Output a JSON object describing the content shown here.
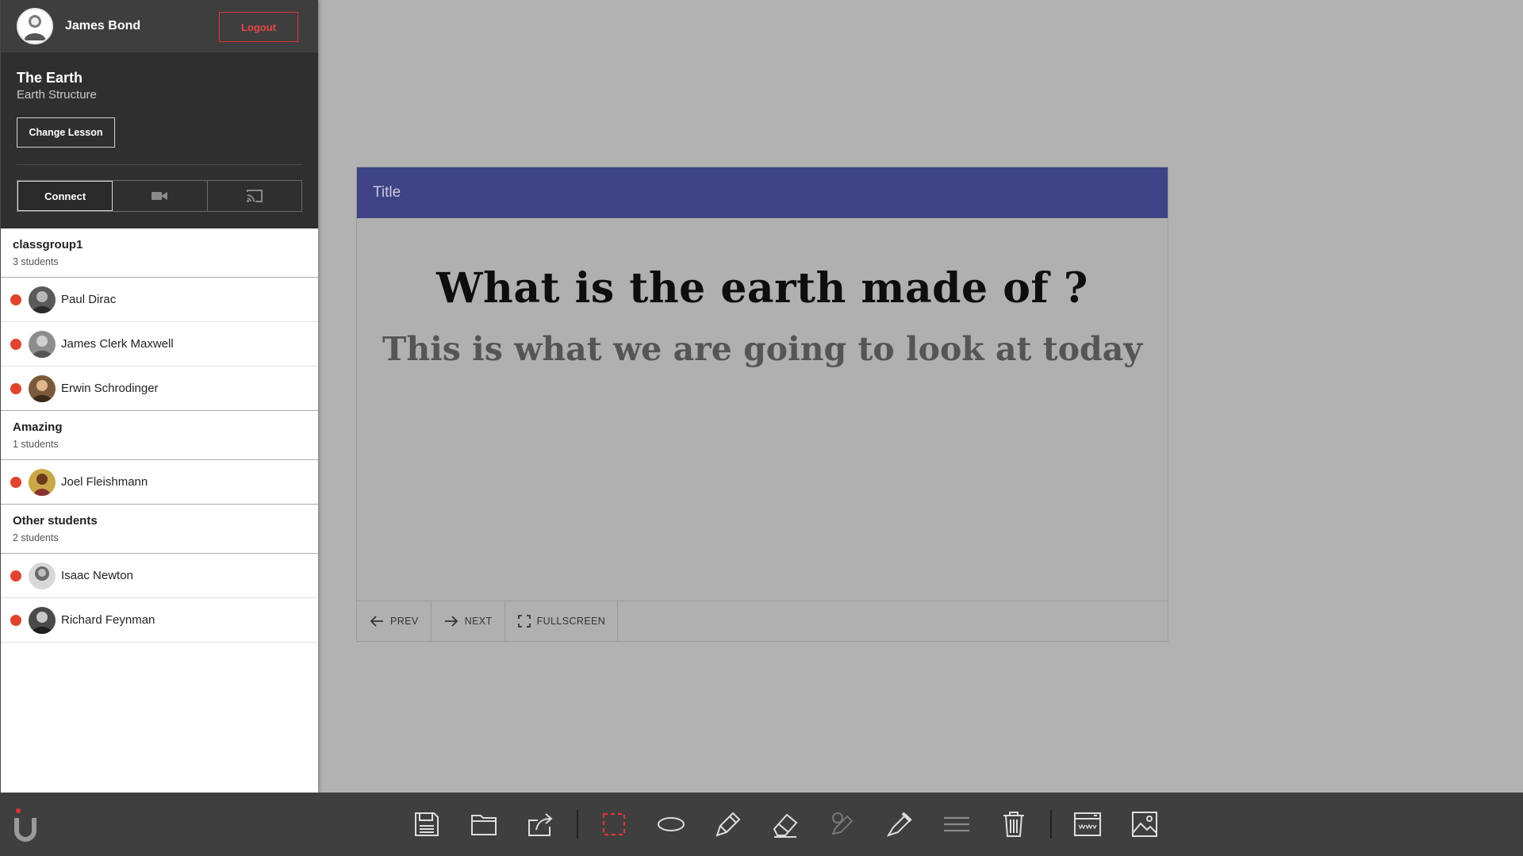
{
  "user": {
    "name": "James Bond",
    "logout_label": "Logout"
  },
  "lesson": {
    "title": "The Earth",
    "subtitle": "Earth Structure",
    "change_label": "Change Lesson"
  },
  "connect": {
    "label": "Connect",
    "video_icon": "video-camera-icon",
    "cast_icon": "cast-icon"
  },
  "groups": [
    {
      "name": "classgroup1",
      "count": "3 students",
      "students": [
        "Paul Dirac",
        "James Clerk Maxwell",
        "Erwin Schrodinger"
      ]
    },
    {
      "name": "Amazing",
      "count": "1 students",
      "students": [
        "Joel Fleishmann"
      ]
    },
    {
      "name": "Other students",
      "count": "2 students",
      "students": [
        "Isaac Newton",
        "Richard Feynman"
      ]
    }
  ],
  "slide": {
    "header": "Title",
    "heading": "What is the earth made of ?",
    "subheading": "This is what we are going to look at today",
    "prev_label": "PREV",
    "next_label": "NEXT",
    "fullscreen_label": "FULLSCREEN"
  },
  "colors": {
    "accent": "#3d4384",
    "status_offline": "#e0442e",
    "logout": "#e03535",
    "select_tool": "#e03535"
  },
  "toolbar_icons": [
    "save-icon",
    "open-folder-icon",
    "share-icon",
    "selection-icon",
    "ellipse-icon",
    "pen-icon",
    "eraser-icon",
    "highlighter-icon",
    "marker-icon",
    "line-width-icon",
    "trash-icon",
    "web-browser-icon",
    "image-icon"
  ]
}
